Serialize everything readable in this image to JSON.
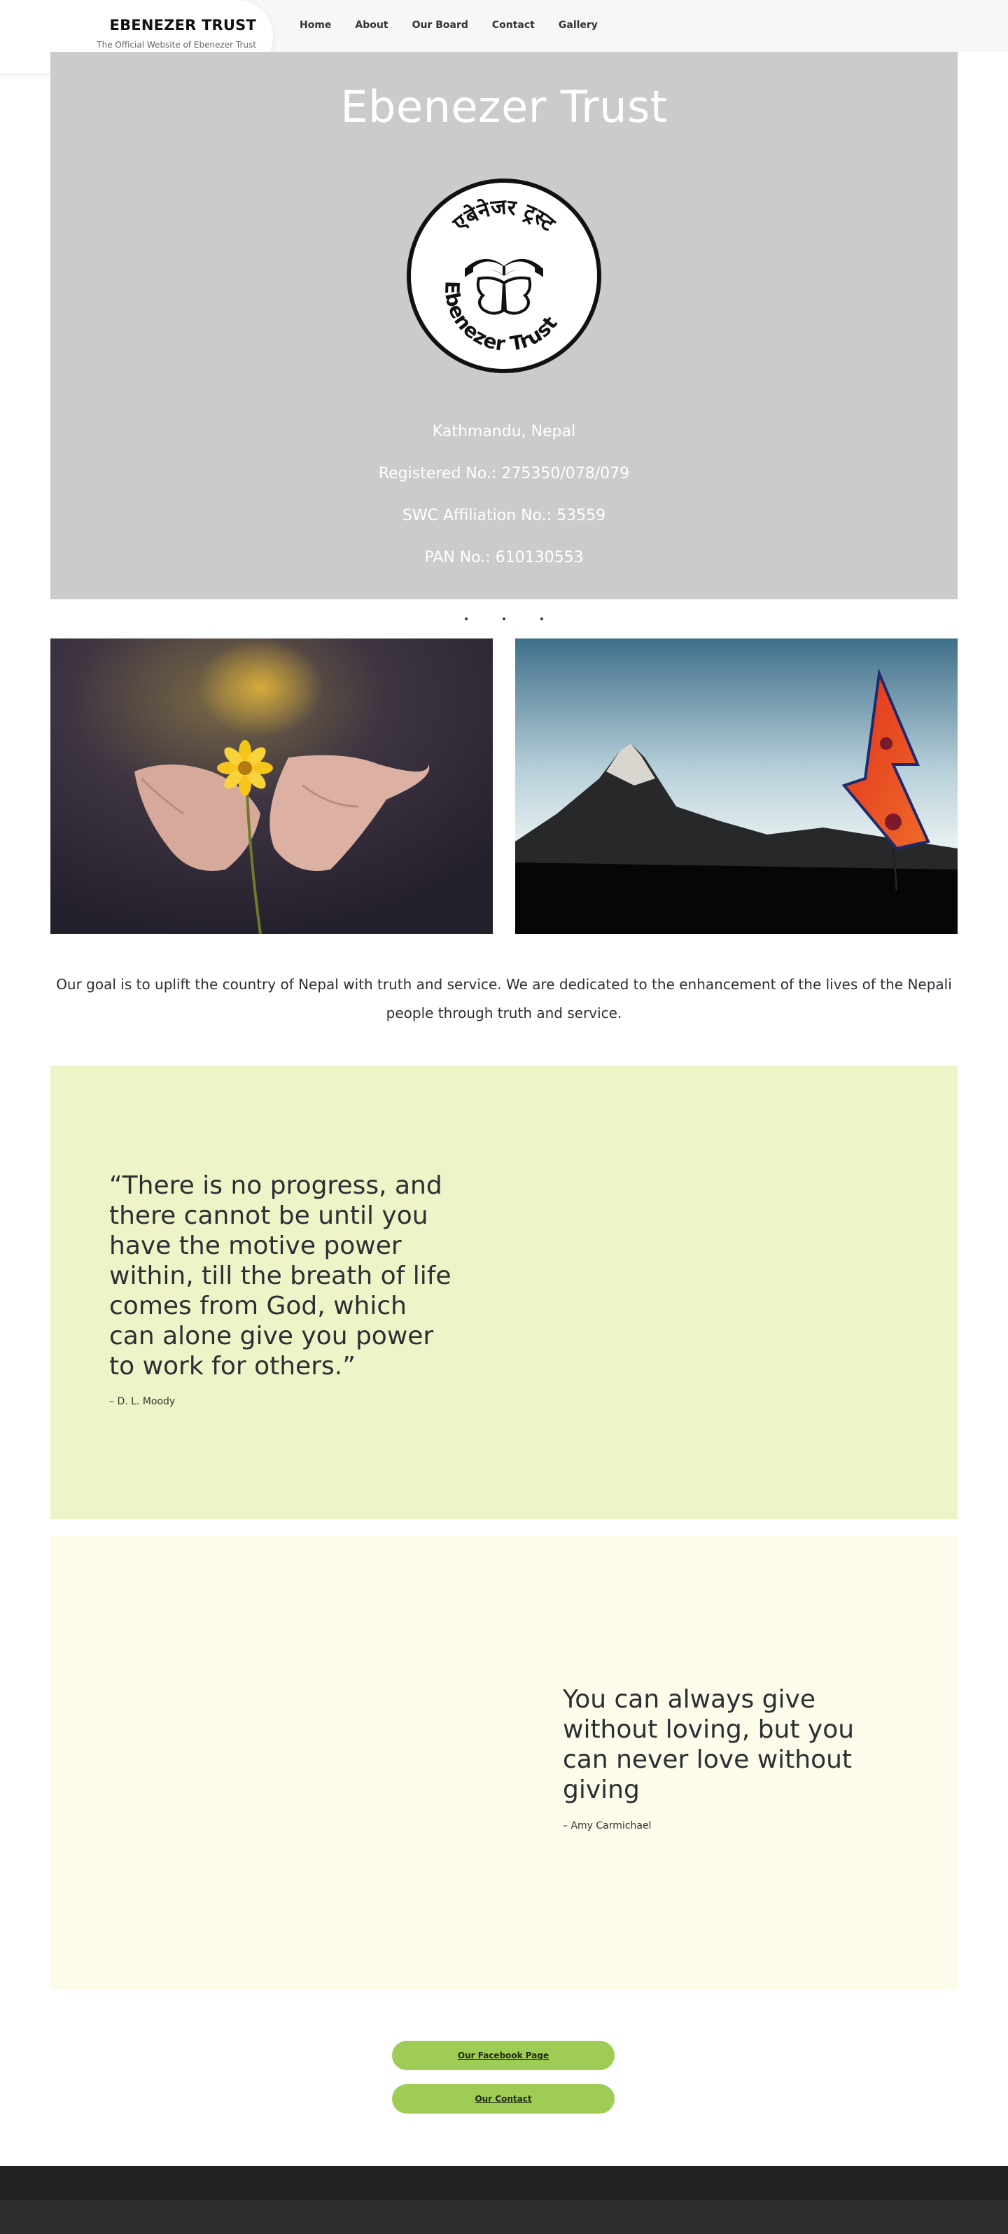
{
  "header": {
    "site_title": "EBENEZER TRUST",
    "tagline": "The Official Website of Ebenezer Trust",
    "nav": [
      "Home",
      "About",
      "Our Board",
      "Contact",
      "Gallery"
    ]
  },
  "hero": {
    "title": "Ebenezer Trust",
    "logo_text_top": "एबेनेजर ट्रस्ट",
    "logo_text_bottom": "Ebenezer Trust",
    "lines": [
      "Kathmandu, Nepal",
      "Registered No.: 275350/078/079",
      "SWC Affiliation No.: 53559",
      "PAN No.: 610130553"
    ],
    "background_color": "#cbcbcb"
  },
  "photos": [
    {
      "name": "hands-holding-flower-photo"
    },
    {
      "name": "mountain-nepal-flag-photo"
    }
  ],
  "goal_text": "Our goal is to uplift the country of Nepal with truth and service. We are dedicated to the enhancement of the lives of the Nepali people through truth and service.",
  "quotes": [
    {
      "text": "“There is no progress, and there cannot be until you have the motive power within, till the breath of life comes from God, which can alone give you power to work for others.”",
      "author": "– D. L. Moody",
      "background_color": "#eff4c8"
    },
    {
      "text": "You can always give without loving, but you can never love without giving",
      "author": "– Amy Carmichael",
      "background_color": "#fdfbea"
    }
  ],
  "buttons": {
    "facebook": "Our Facebook Page",
    "contact": "Our Contact",
    "color": "#9fcc55"
  },
  "colors": {
    "footer": "#222222",
    "text": "#2b2f33"
  }
}
